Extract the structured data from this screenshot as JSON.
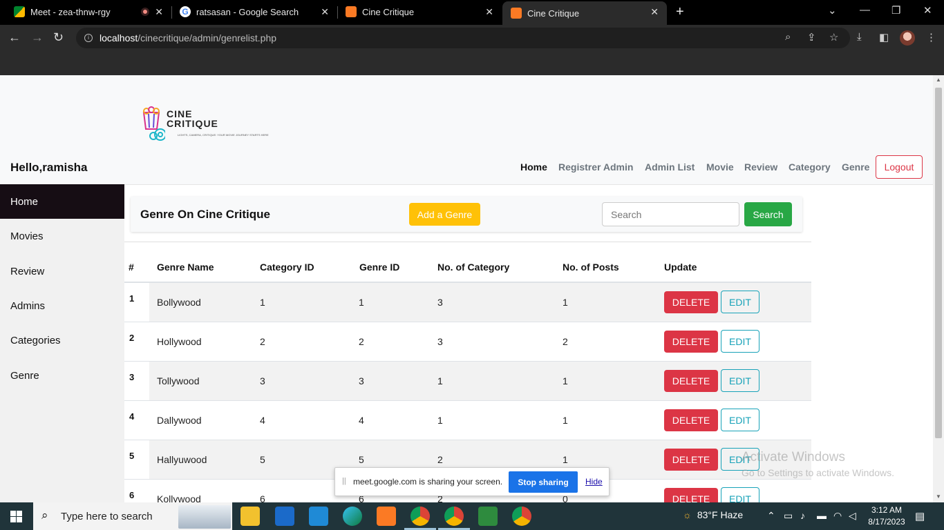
{
  "browser": {
    "tabs": [
      {
        "title": "Meet - zea-thnw-rgy",
        "favicon": "meet-icon",
        "recording": true
      },
      {
        "title": "ratsasan - Google Search",
        "favicon": "google-icon"
      },
      {
        "title": "Cine Critique",
        "favicon": "xampp-icon"
      },
      {
        "title": "Cine Critique",
        "favicon": "xampp-icon",
        "active": true
      }
    ],
    "url_host": "localhost",
    "url_path": "/cinecritique/admin/genrelist.php"
  },
  "logo": {
    "line1": "CINE",
    "line2": "CRITIQUE",
    "tagline": "LIGHTS, CAMERA, CRITIQUE: YOUR MOVIE JOURNEY STARTS HERE"
  },
  "navbar": {
    "greeting": "Hello,ramisha",
    "links": [
      "Home",
      "Registrer Admin",
      "Admin List",
      "Movie",
      "Review",
      "Category",
      "Genre"
    ],
    "logout": "Logout"
  },
  "sidebar": {
    "items": [
      "Home",
      "Movies",
      "Review",
      "Admins",
      "Categories",
      "Genre"
    ]
  },
  "main": {
    "title": "Genre On Cine Critique",
    "add_button": "Add a Genre",
    "search_placeholder": "Search",
    "search_button": "Search"
  },
  "table": {
    "headers": [
      "#",
      "Genre Name",
      "Category ID",
      "Genre ID",
      "No. of Category",
      "No. of Posts",
      "Update"
    ],
    "delete_label": "DELETE",
    "edit_label": "EDIT",
    "rows": [
      {
        "num": "1",
        "name": "Bollywood",
        "category_id": "1",
        "genre_id": "1",
        "num_category": "3",
        "num_posts": "1"
      },
      {
        "num": "2",
        "name": "Hollywood",
        "category_id": "2",
        "genre_id": "2",
        "num_category": "3",
        "num_posts": "2"
      },
      {
        "num": "3",
        "name": "Tollywood",
        "category_id": "3",
        "genre_id": "3",
        "num_category": "1",
        "num_posts": "1"
      },
      {
        "num": "4",
        "name": "Dallywood",
        "category_id": "4",
        "genre_id": "4",
        "num_category": "1",
        "num_posts": "1"
      },
      {
        "num": "5",
        "name": "Hallyuwood",
        "category_id": "5",
        "genre_id": "5",
        "num_category": "2",
        "num_posts": "1"
      },
      {
        "num": "6",
        "name": "Kollywood",
        "category_id": "6",
        "genre_id": "6",
        "num_category": "2",
        "num_posts": "0"
      }
    ]
  },
  "watermark": {
    "line1": "Activate Windows",
    "line2": "Go to Settings to activate Windows."
  },
  "share_bar": {
    "grip": "||",
    "text": "meet.google.com is sharing your screen.",
    "stop": "Stop sharing",
    "hide": "Hide"
  },
  "taskbar": {
    "search_text": "Type here to search",
    "weather": "83°F  Haze",
    "time": "3:12 AM",
    "date": "8/17/2023"
  },
  "colors": {
    "danger": "#dc3545",
    "warning": "#ffc107",
    "success": "#28a745",
    "info": "#17a2b8",
    "sidebar_active": "#160d14",
    "stop_sharing": "#1a73e8"
  }
}
